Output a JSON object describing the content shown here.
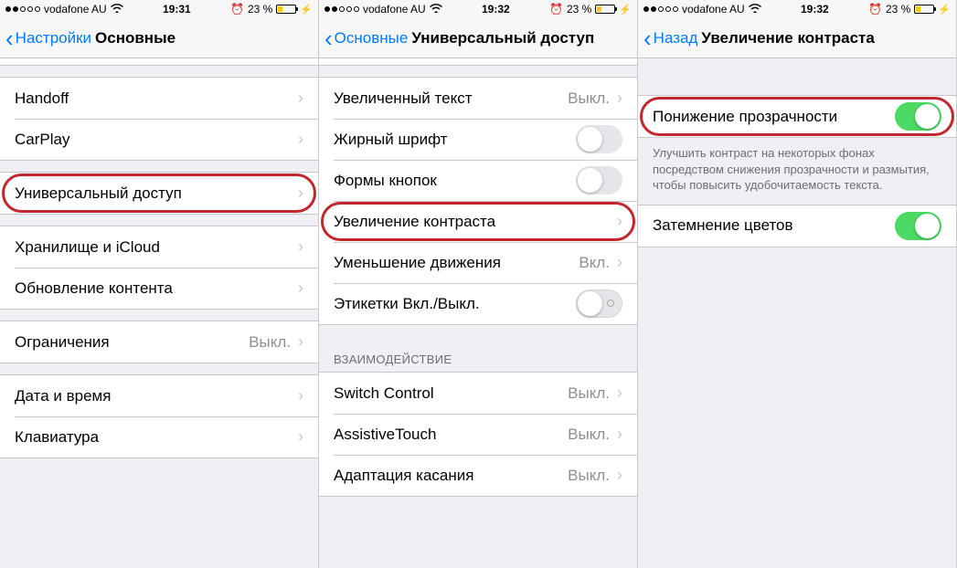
{
  "panes": [
    {
      "status": {
        "carrier": "vodafone AU",
        "time": "19:31",
        "battery": "23 %"
      },
      "nav": {
        "back": "Настройки",
        "title": "Основные"
      },
      "groups": [
        {
          "rows": [
            {
              "label": "Handoff"
            },
            {
              "label": "CarPlay"
            }
          ]
        },
        {
          "rows": [
            {
              "label": "Универсальный доступ",
              "hl": true
            }
          ]
        },
        {
          "rows": [
            {
              "label": "Хранилище и iCloud"
            },
            {
              "label": "Обновление контента"
            }
          ]
        },
        {
          "rows": [
            {
              "label": "Ограничения",
              "detail": "Выкл."
            }
          ]
        },
        {
          "rows": [
            {
              "label": "Дата и время"
            },
            {
              "label": "Клавиатура"
            }
          ]
        }
      ]
    },
    {
      "status": {
        "carrier": "vodafone AU",
        "time": "19:32",
        "battery": "23 %"
      },
      "nav": {
        "back": "Основные",
        "title": "Универсальный доступ"
      },
      "groups": [
        {
          "rows": [
            {
              "label": "Увеличенный текст",
              "detail": "Выкл."
            },
            {
              "label": "Жирный шрифт",
              "type": "switch",
              "on": false
            },
            {
              "label": "Формы кнопок",
              "type": "switch",
              "on": false
            },
            {
              "label": "Увеличение контраста",
              "hl": true
            },
            {
              "label": "Уменьшение движения",
              "detail": "Вкл."
            },
            {
              "label": "Этикетки Вкл./Выкл.",
              "type": "tick",
              "on": false
            }
          ]
        },
        {
          "header": "ВЗАИМОДЕЙСТВИЕ",
          "rows": [
            {
              "label": "Switch Control",
              "detail": "Выкл."
            },
            {
              "label": "AssistiveTouch",
              "detail": "Выкл."
            },
            {
              "label": "Адаптация касания",
              "detail": "Выкл."
            }
          ]
        }
      ]
    },
    {
      "status": {
        "carrier": "vodafone AU",
        "time": "19:32",
        "battery": "23 %"
      },
      "nav": {
        "back": "Назад",
        "title": "Увеличение контраста"
      },
      "groups": [
        {
          "rows": [
            {
              "label": "Понижение прозрачности",
              "type": "switch",
              "on": true,
              "hl": true
            }
          ],
          "footer": "Улучшить контраст на некоторых фонах посредством снижения прозрачности и размытия, чтобы повысить удобочитаемость текста."
        },
        {
          "rows": [
            {
              "label": "Затемнение цветов",
              "type": "switch",
              "on": true
            }
          ]
        }
      ]
    }
  ]
}
